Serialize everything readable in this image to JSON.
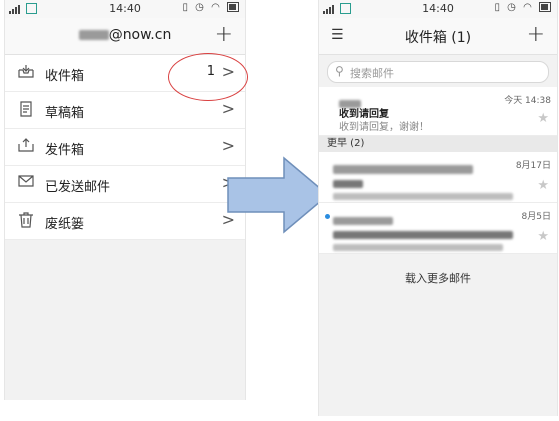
{
  "left": {
    "status": {
      "time": "14:40"
    },
    "header": {
      "account_suffix": "@now.cn",
      "plus": "+"
    },
    "folders": [
      {
        "label": "收件箱",
        "count": "1",
        "icon": "inbox-icon"
      },
      {
        "label": "草稿箱",
        "count": "",
        "icon": "draft-icon"
      },
      {
        "label": "发件箱",
        "count": "",
        "icon": "outbox-icon"
      },
      {
        "label": "已发送邮件",
        "count": "",
        "icon": "sent-mail-icon"
      },
      {
        "label": "废纸篓",
        "count": "",
        "icon": "trash-icon"
      }
    ],
    "chevron": ">"
  },
  "right": {
    "status": {
      "time": "14:40"
    },
    "header": {
      "title": "收件箱 (1)",
      "plus": "+",
      "menu": "☰"
    },
    "search": {
      "placeholder": "搜索邮件"
    },
    "mails_top": [
      {
        "date": "今天 14:38",
        "subject": "收到请回复",
        "preview": "收到请回复，谢谢！"
      }
    ],
    "section_earlier": "更早 (2)",
    "mails_earlier": [
      {
        "date": "8月17日"
      },
      {
        "date": "8月5日"
      }
    ],
    "load_more": "载入更多邮件"
  },
  "colors": {
    "highlight_oval": "#d94040",
    "arrow_fill": "#a9c3e6",
    "arrow_stroke": "#6f8fba",
    "unread_dot": "#2b8de0"
  }
}
